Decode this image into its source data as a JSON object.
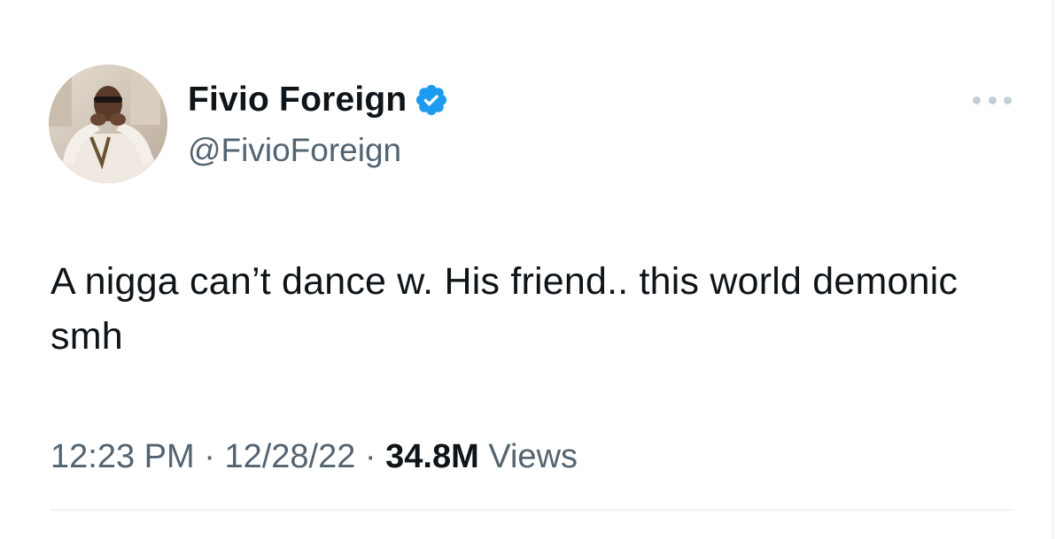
{
  "tweet": {
    "author": {
      "display_name": "Fivio Foreign",
      "handle": "@FivioForeign",
      "verified": true,
      "avatar_icon": "profile-photo"
    },
    "text": "A nigga can’t dance w. His friend.. this world demonic smh",
    "time": "12:23 PM",
    "separator": "·",
    "date": "12/28/22",
    "views_count": "34.8M",
    "views_label": "Views",
    "more_icon": "more-options-icon"
  },
  "colors": {
    "primary_text": "#0f1419",
    "secondary_text": "#536471",
    "verified_blue": "#1d9bf0",
    "divider": "#eff3f4",
    "more_dots": "#c4cfd6"
  }
}
